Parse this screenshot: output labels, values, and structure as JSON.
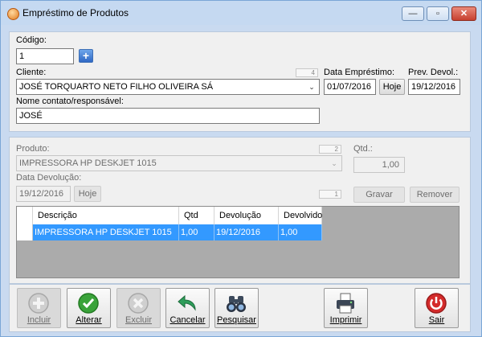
{
  "window": {
    "title": "Empréstimo de Produtos",
    "minimize_glyph": "—",
    "maximize_glyph": "▫",
    "close_glyph": "✕"
  },
  "header": {
    "codigo_label": "Código:",
    "codigo_value": "1",
    "cliente_label": "Cliente:",
    "cliente_counter": "4",
    "cliente_value": "JOSÉ TORQUARTO NETO FILHO OLIVEIRA SÁ",
    "data_emprestimo_label": "Data Empréstimo:",
    "data_emprestimo_value": "01/07/2016",
    "hoje_label": "Hoje",
    "prev_devol_label": "Prev. Devol.:",
    "prev_devol_value": "19/12/2016",
    "contato_label": "Nome contato/responsável:",
    "contato_value": "JOSÉ"
  },
  "item": {
    "produto_label": "Produto:",
    "produto_counter": "2",
    "produto_value": "IMPRESSORA HP DESKJET 1015",
    "qtd_label": "Qtd.:",
    "qtd_value": "1,00",
    "data_devolucao_label": "Data Devolução:",
    "data_devolucao_value": "19/12/2016",
    "hoje_label": "Hoje",
    "item_counter": "1",
    "gravar_label": "Gravar",
    "remover_label": "Remover"
  },
  "grid": {
    "columns": [
      "Descrição",
      "Qtd",
      "Devolução",
      "Devolvido"
    ],
    "rows": [
      [
        "IMPRESSORA HP DESKJET 1015",
        "1,00",
        "19/12/2016",
        "1,00"
      ]
    ]
  },
  "toolbar": {
    "incluir": "Incluir",
    "alterar": "Alterar",
    "excluir": "Excluir",
    "cancelar": "Cancelar",
    "pesquisar": "Pesquisar",
    "imprimir": "Imprimir",
    "sair": "Sair"
  },
  "icons": {
    "app": "app-icon",
    "add": "plus-icon",
    "incluir": "plus-circle-icon",
    "alterar": "checkmark-icon",
    "excluir": "x-circle-icon",
    "cancelar": "undo-arrow-icon",
    "pesquisar": "binoculars-icon",
    "imprimir": "printer-icon",
    "sair": "power-icon"
  },
  "colors": {
    "selection": "#3399ff",
    "window_frame": "#c5d9f1",
    "close_button": "#c74130",
    "sair_red": "#d42b2b",
    "alterar_green": "#3aa33a",
    "cancelar_green": "#2e9e5a"
  }
}
